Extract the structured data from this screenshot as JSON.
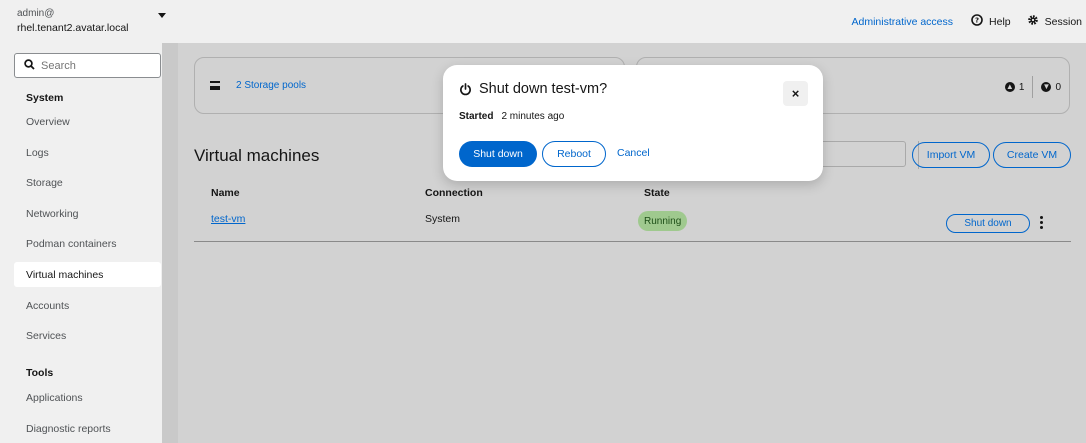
{
  "header": {
    "user": "admin@",
    "host": "rhel.tenant2.avatar.local",
    "admin_access": "Administrative access",
    "help": "Help",
    "session": "Session"
  },
  "sidebar": {
    "search_placeholder": "Search",
    "system_heading": "System",
    "system_items": [
      "Overview",
      "Logs",
      "Storage",
      "Networking",
      "Podman containers",
      "Virtual machines",
      "Accounts",
      "Services"
    ],
    "active_item": "Virtual machines",
    "tools_heading": "Tools",
    "tools_items": [
      "Applications",
      "Diagnostic reports"
    ]
  },
  "main": {
    "storage_pools_link": "2 Storage pools",
    "network_counts": {
      "up": "1",
      "down": "0"
    },
    "title": "Virtual machines",
    "import_button": "Import VM",
    "create_button": "Create VM",
    "table": {
      "columns": [
        "Name",
        "Connection",
        "State"
      ],
      "rows": [
        {
          "name": "test-vm",
          "connection": "System",
          "state": "Running",
          "action": "Shut down"
        }
      ]
    }
  },
  "modal": {
    "title": "Shut down test-vm?",
    "meta_label": "Started",
    "meta_value": "2 minutes ago",
    "primary_button": "Shut down",
    "secondary_button": "Reboot",
    "link_button": "Cancel",
    "close_glyph": "×"
  },
  "colors": {
    "accent": "#0066cc",
    "running_badge": "#9fc98e",
    "backdrop": "#d2d2d2"
  }
}
